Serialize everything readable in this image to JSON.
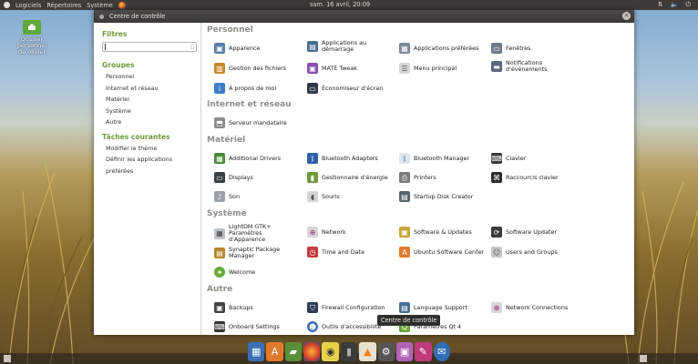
{
  "topbar": {
    "menu": [
      "Logiciels",
      "Répertoires",
      "Système"
    ],
    "clock": "sam. 16 avril, 20:09"
  },
  "desktop": {
    "folder_line1": "Dossier personnel",
    "folder_line2": "de olivier"
  },
  "window": {
    "title": "Centre de contrôle"
  },
  "sidebar": {
    "filters_title": "Filtres",
    "search_value": "",
    "groups_title": "Groupes",
    "groups": [
      "Personnel",
      "Internet et réseau",
      "Matériel",
      "Système",
      "Autre"
    ],
    "tasks_title": "Tâches courantes",
    "tasks": [
      "Modifier le thème",
      "Définir les applications préférées"
    ]
  },
  "sections": {
    "personnel": "Personnel",
    "internet": "Internet et réseau",
    "materiel": "Matériel",
    "systeme": "Système",
    "autre": "Autre"
  },
  "items": {
    "personnel": [
      "Apparence",
      "Applications au démarrage",
      "Applications préférées",
      "Fenêtres",
      "Gestion des fichiers",
      "MATE Tweak",
      "Menu principal",
      "Notifications d'événements",
      "À propos de moi",
      "Économiseur d'écran"
    ],
    "internet": [
      "Serveur mandataire"
    ],
    "materiel": [
      "Additional Drivers",
      "Bluetooth Adapters",
      "Bluetooth Manager",
      "Clavier",
      "Displays",
      "Gestionnaire d'énergie",
      "Printers",
      "Raccourcis clavier",
      "Son",
      "Souris",
      "Startup Disk Creator"
    ],
    "systeme": [
      "LightDM GTK+ Paramètres d'Apparence",
      "Network",
      "Software & Updates",
      "Software Updater",
      "Synaptic Package Manager",
      "Time and Date",
      "Ubuntu Software Center",
      "Users and Groups",
      "Welcome"
    ],
    "autre": [
      "Backups",
      "Firewall Configuration",
      "Language Support",
      "Network Connections",
      "Onboard Settings",
      "Outils d'accessibilité",
      "Paramètres Qt 4"
    ]
  },
  "tooltip": "Centre de contrôle",
  "colors": {
    "section_heading": "#8b8f87",
    "sidebar_heading": "#6b9b3a",
    "panel": "#3c3b37",
    "dock_active": "#b063b8"
  }
}
